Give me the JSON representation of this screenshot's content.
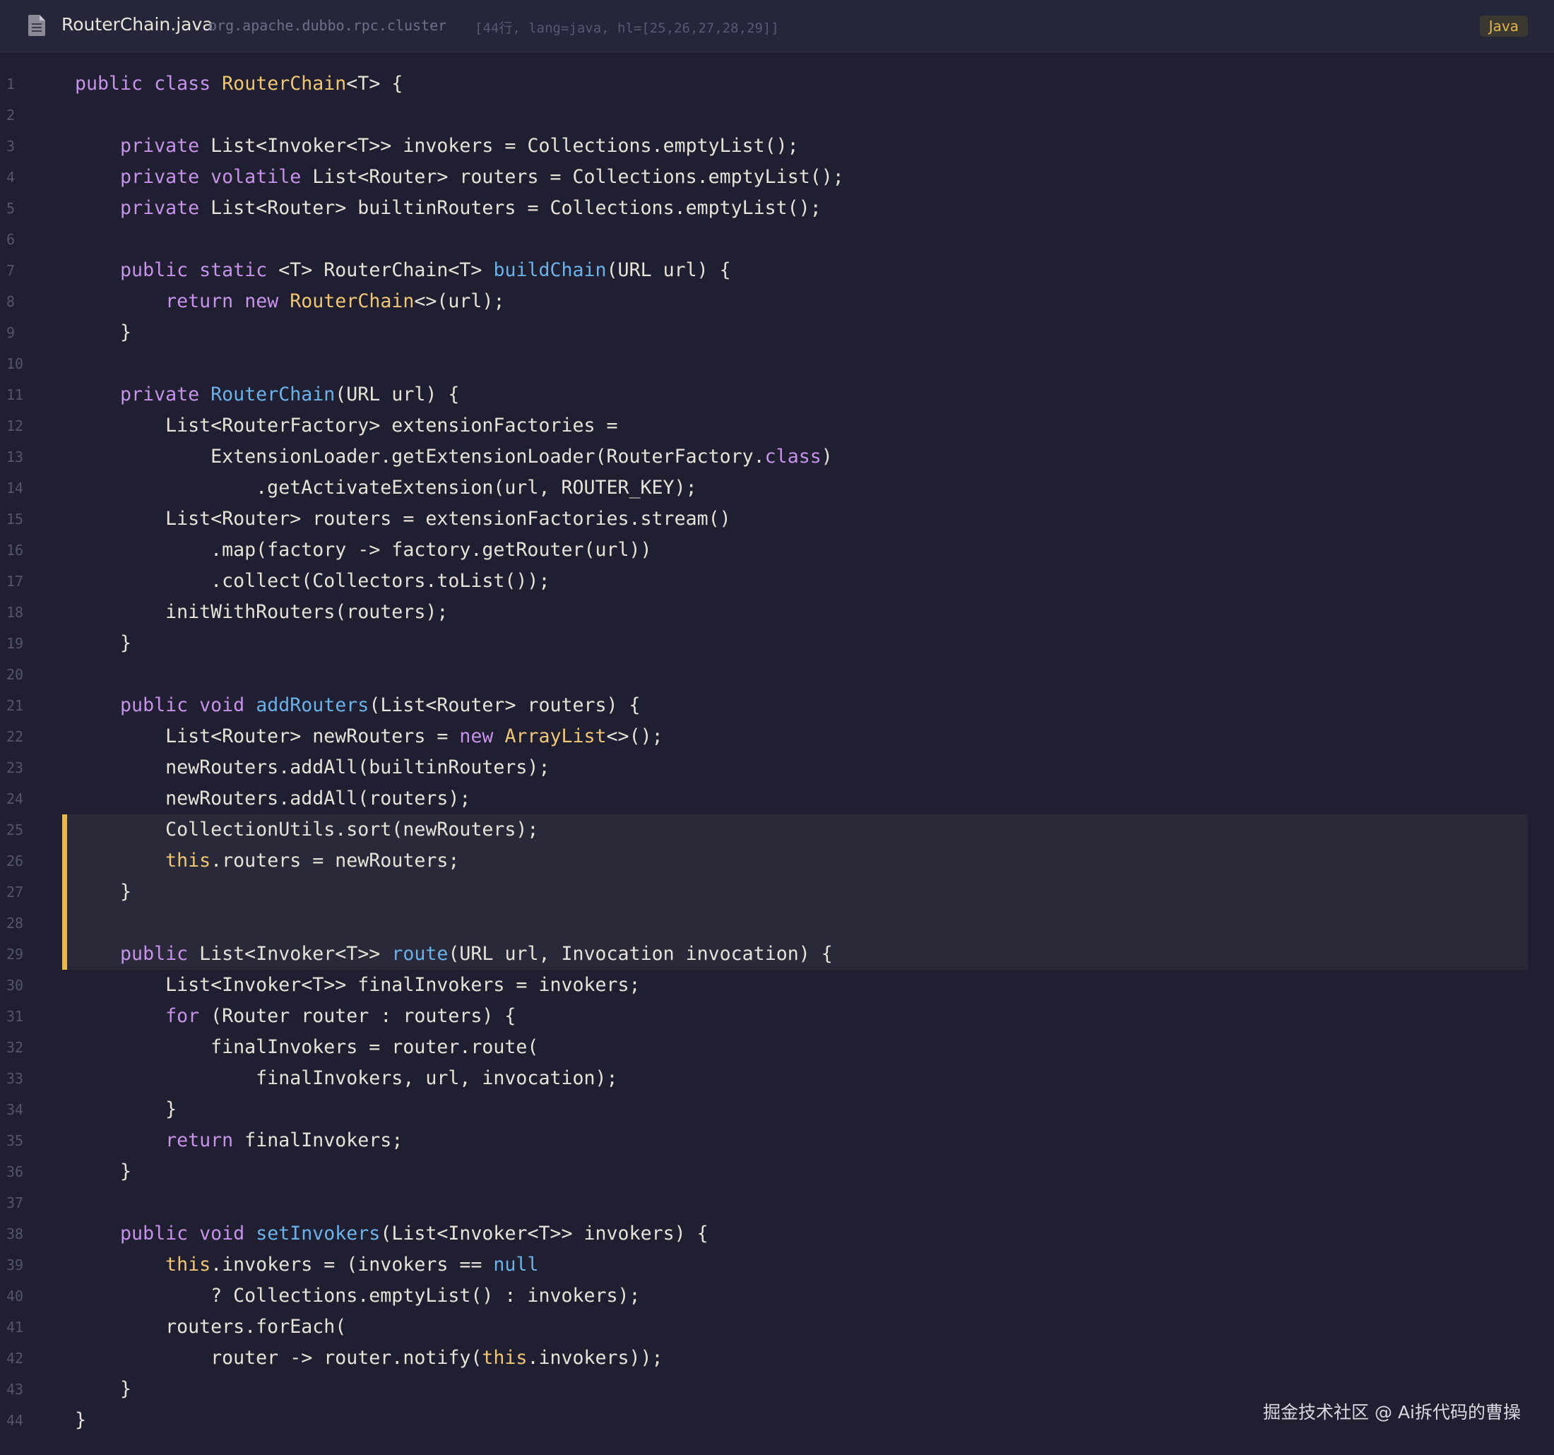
{
  "header": {
    "file_name": "RouterChain.java",
    "package": "org.apache.dubbo.rpc.cluster",
    "meta": "[44行, lang=java, hl=[25,26,27,28,29]]",
    "language_badge": "Java",
    "icon": "file-icon"
  },
  "editor": {
    "highlight_color": "#e8b84a",
    "highlighted_lines": [
      25,
      26,
      27,
      28,
      29
    ],
    "lines": [
      {
        "n": "1",
        "code": "public class RouterChain<T> {"
      },
      {
        "n": "2",
        "code": ""
      },
      {
        "n": "3",
        "code": "    private List<Invoker<T>> invokers = Collections.emptyList();"
      },
      {
        "n": "4",
        "code": "    private volatile List<Router> routers = Collections.emptyList();"
      },
      {
        "n": "5",
        "code": "    private List<Router> builtinRouters = Collections.emptyList();"
      },
      {
        "n": "6",
        "code": ""
      },
      {
        "n": "7",
        "code": "    public static <T> RouterChain<T> buildChain(URL url) {"
      },
      {
        "n": "8",
        "code": "        return new RouterChain<>(url);"
      },
      {
        "n": "9",
        "code": "    }"
      },
      {
        "n": "10",
        "code": ""
      },
      {
        "n": "11",
        "code": "    private RouterChain(URL url) {"
      },
      {
        "n": "12",
        "code": "        List<RouterFactory> extensionFactories ="
      },
      {
        "n": "13",
        "code": "            ExtensionLoader.getExtensionLoader(RouterFactory.class)"
      },
      {
        "n": "14",
        "code": "                .getActivateExtension(url, ROUTER_KEY);"
      },
      {
        "n": "15",
        "code": "        List<Router> routers = extensionFactories.stream()"
      },
      {
        "n": "16",
        "code": "            .map(factory -> factory.getRouter(url))"
      },
      {
        "n": "17",
        "code": "            .collect(Collectors.toList());"
      },
      {
        "n": "18",
        "code": "        initWithRouters(routers);"
      },
      {
        "n": "19",
        "code": "    }"
      },
      {
        "n": "20",
        "code": ""
      },
      {
        "n": "21",
        "code": "    public void addRouters(List<Router> routers) {"
      },
      {
        "n": "22",
        "code": "        List<Router> newRouters = new ArrayList<>();"
      },
      {
        "n": "23",
        "code": "        newRouters.addAll(builtinRouters);"
      },
      {
        "n": "24",
        "code": "        newRouters.addAll(routers);"
      },
      {
        "n": "25",
        "code": "        CollectionUtils.sort(newRouters);"
      },
      {
        "n": "26",
        "code": "        this.routers = newRouters;"
      },
      {
        "n": "27",
        "code": "    }"
      },
      {
        "n": "28",
        "code": ""
      },
      {
        "n": "29",
        "code": "    public List<Invoker<T>> route(URL url, Invocation invocation) {"
      },
      {
        "n": "30",
        "code": "        List<Invoker<T>> finalInvokers = invokers;"
      },
      {
        "n": "31",
        "code": "        for (Router router : routers) {"
      },
      {
        "n": "32",
        "code": "            finalInvokers = router.route("
      },
      {
        "n": "33",
        "code": "                finalInvokers, url, invocation);"
      },
      {
        "n": "34",
        "code": "        }"
      },
      {
        "n": "35",
        "code": "        return finalInvokers;"
      },
      {
        "n": "36",
        "code": "    }"
      },
      {
        "n": "37",
        "code": ""
      },
      {
        "n": "38",
        "code": "    public void setInvokers(List<Invoker<T>> invokers) {"
      },
      {
        "n": "39",
        "code": "        this.invokers = (invokers == null"
      },
      {
        "n": "40",
        "code": "            ? Collections.emptyList() : invokers);"
      },
      {
        "n": "41",
        "code": "        routers.forEach("
      },
      {
        "n": "42",
        "code": "            router -> router.notify(this.invokers));"
      },
      {
        "n": "43",
        "code": "    }"
      },
      {
        "n": "44",
        "code": "}"
      }
    ]
  },
  "watermark": "掘金技术社区 @ Ai拆代码的曹操"
}
